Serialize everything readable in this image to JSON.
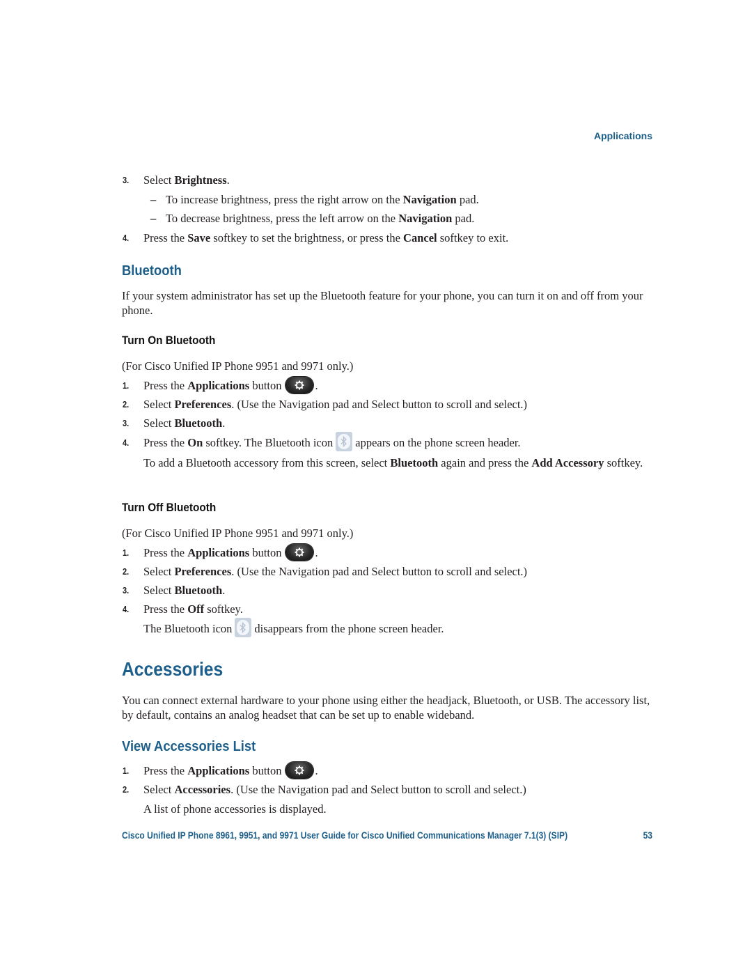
{
  "header": {
    "section": "Applications"
  },
  "brightness_steps": {
    "step3": {
      "num": "3.",
      "pre": "Select ",
      "bold": "Brightness",
      "post": "."
    },
    "sub1": {
      "dash": "–",
      "pre": "To increase brightness, press the right arrow on the ",
      "bold": "Navigation",
      "post": " pad."
    },
    "sub2": {
      "dash": "–",
      "pre": "To decrease brightness, press the left arrow on the ",
      "bold": "Navigation",
      "post": " pad."
    },
    "step4": {
      "num": "4.",
      "pre": "Press the ",
      "bold1": "Save",
      "mid": " softkey to set the brightness, or press the ",
      "bold2": "Cancel",
      "post": " softkey to exit."
    }
  },
  "bluetooth": {
    "heading": "Bluetooth",
    "intro": "If your system administrator has set up the Bluetooth feature for your phone, you can turn it on and off from your phone.",
    "turn_on": {
      "heading": "Turn On Bluetooth",
      "note": "(For Cisco Unified IP Phone 9951 and 9971 only.)",
      "step1": {
        "num": "1.",
        "pre": "Press the ",
        "bold": "Applications",
        "post": " button",
        "end": "."
      },
      "step2": {
        "num": "2.",
        "pre": "Select ",
        "bold": "Preferences",
        "post": ". (Use the Navigation pad and Select button to scroll and select.)"
      },
      "step3": {
        "num": "3.",
        "pre": "Select ",
        "bold": "Bluetooth",
        "post": "."
      },
      "step4": {
        "num": "4.",
        "pre": "Press the ",
        "bold": "On",
        "mid": " softkey. The Bluetooth icon",
        "post": "appears on the phone screen header."
      },
      "step4_note": {
        "pre": "To add a Bluetooth accessory from this screen, select ",
        "bold1": "Bluetooth",
        "mid": " again and press the ",
        "bold2": "Add Accessory",
        "post": " softkey."
      }
    },
    "turn_off": {
      "heading": "Turn Off Bluetooth",
      "note": "(For Cisco Unified IP Phone 9951 and 9971 only.)",
      "step1": {
        "num": "1.",
        "pre": "Press the ",
        "bold": "Applications",
        "post": " button",
        "end": "."
      },
      "step2": {
        "num": "2.",
        "pre": "Select ",
        "bold": "Preferences",
        "post": ". (Use the Navigation pad and Select button to scroll and select.)"
      },
      "step3": {
        "num": "3.",
        "pre": "Select ",
        "bold": "Bluetooth",
        "post": "."
      },
      "step4": {
        "num": "4.",
        "pre": "Press the ",
        "bold": "Off",
        "post": " softkey."
      },
      "step4_note": {
        "pre": "The Bluetooth icon",
        "post": "disappears from the phone screen header."
      }
    }
  },
  "accessories": {
    "heading": "Accessories",
    "intro": "You can connect external hardware to your phone using either the headjack, Bluetooth, or USB. The accessory list, by default, contains an analog headset that can be set up to enable wideband.",
    "view_list": {
      "heading": "View Accessories List",
      "step1": {
        "num": "1.",
        "pre": "Press the ",
        "bold": "Applications",
        "post": " button",
        "end": "."
      },
      "step2": {
        "num": "2.",
        "pre": "Select ",
        "bold": "Accessories",
        "post": ". (Use the Navigation pad and Select button to scroll and select.)"
      },
      "step2_note": "A list of phone accessories is displayed."
    }
  },
  "icons": {
    "applications_button": "gear-icon",
    "bluetooth_status": "bluetooth-icon"
  },
  "footer": {
    "title": "Cisco Unified IP Phone 8961, 9951, and 9971 User Guide for Cisco Unified Communications Manager 7.1(3) (SIP)",
    "page_number": "53"
  },
  "colors": {
    "heading_blue": "#1d5f8a",
    "body_text": "#231f20"
  }
}
